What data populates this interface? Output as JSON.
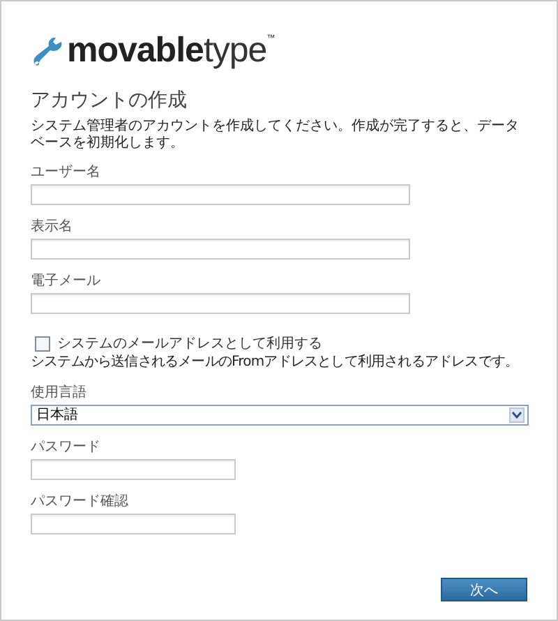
{
  "logo": {
    "bold": "movable",
    "light": "type",
    "mark": "™"
  },
  "title": "アカウントの作成",
  "intro": "システム管理者のアカウントを作成してください。作成が完了すると、データベースを初期化します。",
  "fields": [
    {
      "kind": "text",
      "label": "ユーザー名"
    },
    {
      "kind": "text",
      "label": "表示名"
    },
    {
      "kind": "text",
      "label": "電子メール"
    },
    {
      "kind": "checkbox",
      "label": "システムのメールアドレスとして利用する",
      "checked": false,
      "hint": "システムから送信されるメールのFromアドレスとして利用されるアドレスです。"
    },
    {
      "kind": "select",
      "label": "使用言語",
      "value": "日本語"
    },
    {
      "kind": "password",
      "label": "パスワード"
    },
    {
      "kind": "password",
      "label": "パスワード確認"
    }
  ],
  "next_button": "次へ"
}
